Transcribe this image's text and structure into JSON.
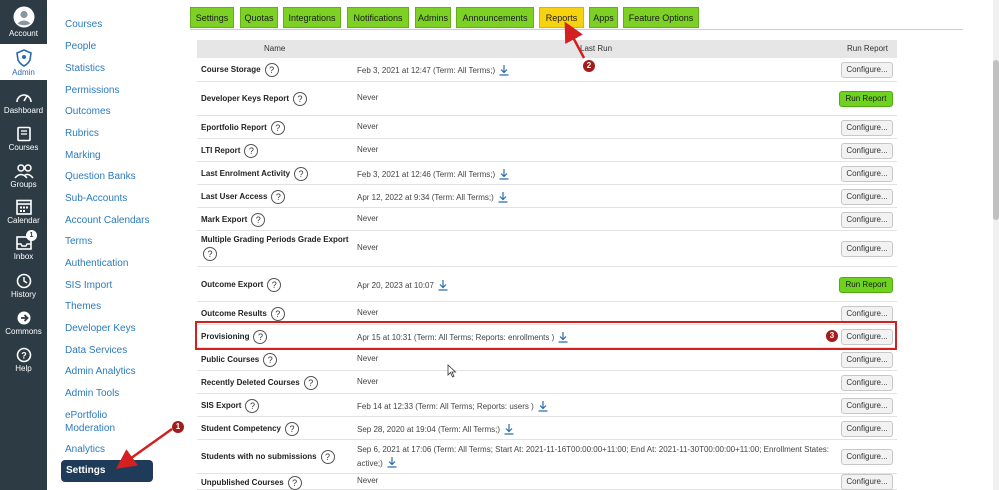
{
  "global_nav": [
    {
      "label": "Account",
      "icon": "account-icon",
      "active": false
    },
    {
      "label": "Admin",
      "icon": "shield-icon",
      "active": true
    },
    {
      "label": "Dashboard",
      "icon": "dashboard-icon",
      "active": false
    },
    {
      "label": "Courses",
      "icon": "book-icon",
      "active": false
    },
    {
      "label": "Groups",
      "icon": "groups-icon",
      "active": false
    },
    {
      "label": "Calendar",
      "icon": "calendar-icon",
      "active": false
    },
    {
      "label": "Inbox",
      "icon": "inbox-icon",
      "active": false,
      "badge": "1"
    },
    {
      "label": "History",
      "icon": "clock-icon",
      "active": false
    },
    {
      "label": "Commons",
      "icon": "commons-icon",
      "active": false
    },
    {
      "label": "Help",
      "icon": "help-icon",
      "active": false
    }
  ],
  "sub_nav": [
    "Courses",
    "People",
    "Statistics",
    "Permissions",
    "Outcomes",
    "Rubrics",
    "Marking",
    "Question Banks",
    "Sub-Accounts",
    "Account Calendars",
    "Terms",
    "Authentication",
    "SIS Import",
    "Themes",
    "Developer Keys",
    "Data Services",
    "Admin Analytics",
    "Admin Tools",
    "ePortfolio Moderation",
    "Analytics",
    "Settings"
  ],
  "tabs": [
    "Settings",
    "Quotas",
    "Integrations",
    "Notifications",
    "Admins",
    "Announcements",
    "Reports",
    "Apps",
    "Feature Options"
  ],
  "active_tab": "Reports",
  "table": {
    "headers": {
      "name": "Name",
      "last_run": "Last Run",
      "run_report": "Run Report"
    },
    "rows": [
      {
        "name": "Course Storage",
        "last_run": "Feb 3, 2021 at 12:47 (Term: All Terms;)",
        "download": true,
        "action": "Configure..."
      },
      {
        "name": "Developer Keys Report",
        "last_run": "Never",
        "download": false,
        "action": "Run Report"
      },
      {
        "name": "Eportfolio Report",
        "last_run": "Never",
        "download": false,
        "action": "Configure..."
      },
      {
        "name": "LTI Report",
        "last_run": "Never",
        "download": false,
        "action": "Configure..."
      },
      {
        "name": "Last Enrolment Activity",
        "last_run": "Feb 3, 2021 at 12:46 (Term: All Terms;)",
        "download": true,
        "action": "Configure..."
      },
      {
        "name": "Last User Access",
        "last_run": "Apr 12, 2022 at 9:34 (Term: All Terms;)",
        "download": true,
        "action": "Configure..."
      },
      {
        "name": "Mark Export",
        "last_run": "Never",
        "download": false,
        "action": "Configure..."
      },
      {
        "name": "Multiple Grading Periods Grade Export",
        "last_run": "Never",
        "download": false,
        "action": "Configure..."
      },
      {
        "name": "Outcome Export",
        "last_run": "Apr 20, 2023 at 10:07",
        "download": true,
        "action": "Run Report"
      },
      {
        "name": "Outcome Results",
        "last_run": "Never",
        "download": false,
        "action": "Configure..."
      },
      {
        "name": "Provisioning",
        "last_run": "Apr 15 at 10:31 (Term: All Terms; Reports: enrollments )",
        "download": true,
        "action": "Configure..."
      },
      {
        "name": "Public Courses",
        "last_run": "Never",
        "download": false,
        "action": "Configure..."
      },
      {
        "name": "Recently Deleted Courses",
        "last_run": "Never",
        "download": false,
        "action": "Configure..."
      },
      {
        "name": "SIS Export",
        "last_run": "Feb 14 at 12:33 (Term: All Terms; Reports: users )",
        "download": true,
        "action": "Configure..."
      },
      {
        "name": "Student Competency",
        "last_run": "Sep 28, 2020 at 19:04 (Term: All Terms;)",
        "download": true,
        "action": "Configure..."
      },
      {
        "name": "Students with no submissions",
        "last_run": "Sep 6, 2021 at 17:06 (Term: All Terms; Start At: 2021-11-16T00:00:00+11:00; End At: 2021-11-30T00:00:00+11:00; Enrollment States: active;)",
        "download": true,
        "action": "Configure..."
      },
      {
        "name": "Unpublished Courses",
        "last_run": "Never",
        "download": false,
        "action": "Configure..."
      }
    ]
  },
  "annotations": [
    "1",
    "2",
    "3"
  ],
  "colors": {
    "nav_bg": "#2d3b45",
    "tab_green": "#7cd124",
    "tab_active": "#f7d20f",
    "run_green": "#6ed21e",
    "callout_red": "#d42020",
    "link_blue": "#2b7abc"
  }
}
